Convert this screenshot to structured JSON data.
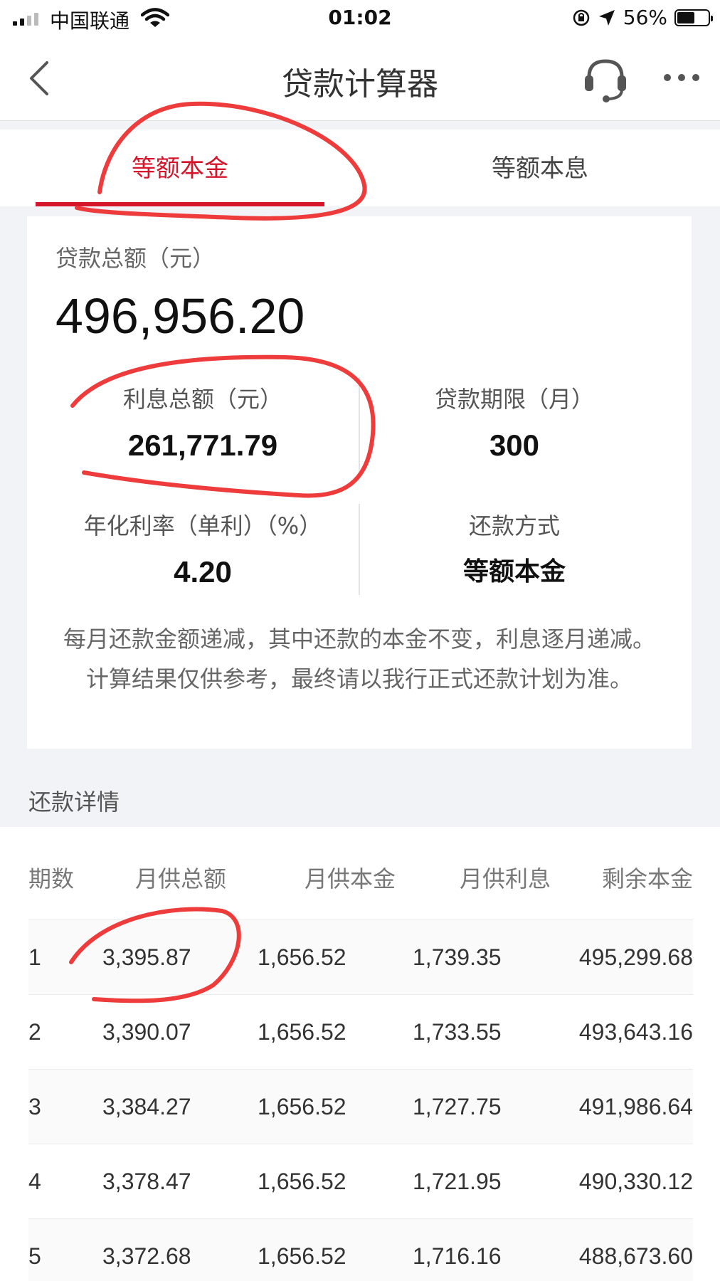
{
  "status_bar": {
    "carrier": "中国联通",
    "time": "01:02",
    "battery_percent": "56%",
    "battery_level": 0.56
  },
  "nav": {
    "title": "贷款计算器",
    "back_icon": "chevron-left-icon",
    "support_icon": "headset-icon",
    "more_icon": "more-dots-icon"
  },
  "tabs": [
    {
      "label": "等额本金",
      "active": true
    },
    {
      "label": "等额本息",
      "active": false
    }
  ],
  "summary": {
    "loan_total_label": "贷款总额（元）",
    "loan_total_value": "496,956.20",
    "interest_total_label": "利息总额（元）",
    "interest_total_value": "261,771.79",
    "term_label": "贷款期限（月）",
    "term_value": "300",
    "rate_label": "年化利率（单利）（%）",
    "rate_value": "4.20",
    "method_label": "还款方式",
    "method_value": "等额本金",
    "note": "每月还款金额递减，其中还款的本金不变，利息逐月递减。计算结果仅供参考，最终请以我行正式还款计划为准。"
  },
  "detail": {
    "header": "还款详情",
    "columns": [
      "期数",
      "月供总额",
      "月供本金",
      "月供利息",
      "剩余本金"
    ],
    "rows": [
      [
        "1",
        "3,395.87",
        "1,656.52",
        "1,739.35",
        "495,299.68"
      ],
      [
        "2",
        "3,390.07",
        "1,656.52",
        "1,733.55",
        "493,643.16"
      ],
      [
        "3",
        "3,384.27",
        "1,656.52",
        "1,727.75",
        "491,986.64"
      ],
      [
        "4",
        "3,378.47",
        "1,656.52",
        "1,721.95",
        "490,330.12"
      ],
      [
        "5",
        "3,372.68",
        "1,656.52",
        "1,716.16",
        "488,673.60"
      ]
    ]
  },
  "colors": {
    "accent_red": "#d6152a",
    "annotation_red": "#ee3b3b"
  }
}
